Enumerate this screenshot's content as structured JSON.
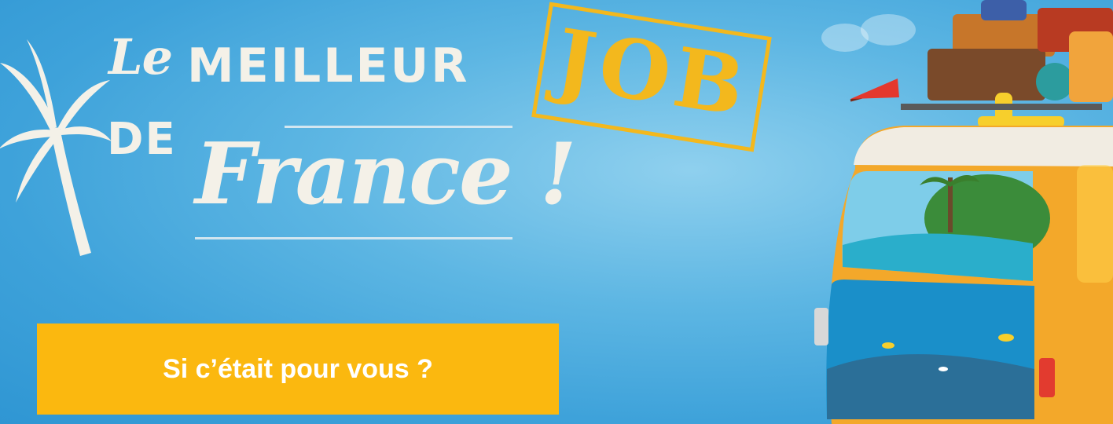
{
  "headline": {
    "le": "Le",
    "meilleur": "MEILLEUR",
    "de": "DE",
    "france": "France !"
  },
  "stamp": {
    "text": "JOB",
    "color": "#f3b81d"
  },
  "cta": {
    "label": "Si c’était pour vous ?",
    "color": "#fbb80f"
  },
  "colors": {
    "sky": "#3ea2da",
    "headline": "#f4f1e8"
  }
}
